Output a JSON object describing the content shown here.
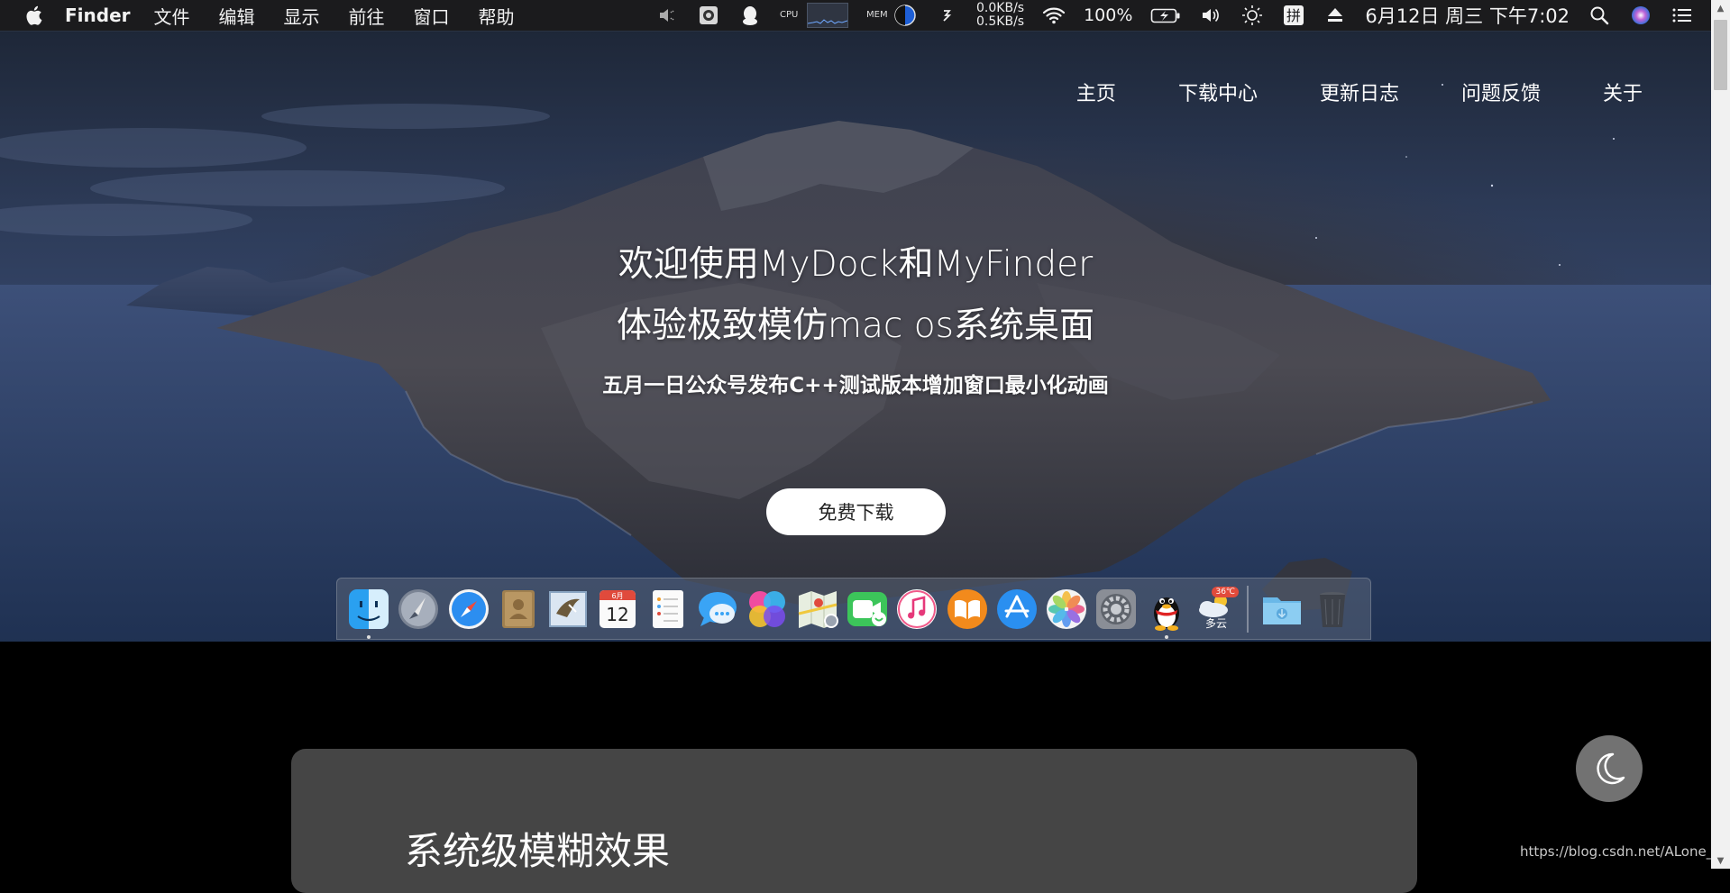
{
  "menubar": {
    "app_name": "Finder",
    "menus": [
      "文件",
      "编辑",
      "显示",
      "前往",
      "窗口",
      "帮助"
    ],
    "net_up": "0.0KB/s",
    "net_down": "0.5KB/s",
    "cpu_label": "CPU",
    "mem_label": "MEM",
    "battery": "100%",
    "clock": "6月12日 周三 下午7:02",
    "icons": [
      "apple-logo",
      "speaker-mute-icon",
      "screenshot-icon",
      "qq-icon",
      "cpu-graph",
      "memory-pie",
      "refresh-icon",
      "wifi-icon",
      "battery-charging-icon",
      "volume-icon",
      "brightness-icon",
      "pinyin-input-icon",
      "eject-icon",
      "spotlight-search-icon",
      "siri-icon",
      "notification-center-icon"
    ]
  },
  "hero": {
    "nav": [
      "主页",
      "下载中心",
      "更新日志",
      "问题反馈",
      "关于"
    ],
    "headline_1": "欢迎使用MyDock和MyFinder",
    "headline_2": "体验极致模仿mac os系统桌面",
    "subline": "五月一日公众号发布C++测试版本增加窗口最小化动画",
    "download_button": "免费下载"
  },
  "dock": {
    "apps": [
      "finder",
      "launchpad",
      "safari",
      "contacts",
      "mail",
      "calendar",
      "reminders",
      "messages",
      "game-center",
      "maps",
      "facetime",
      "itunes",
      "ibooks",
      "app-store",
      "photos",
      "system-preferences",
      "qq",
      "weather"
    ],
    "calendar_month": "6月",
    "calendar_day": "12",
    "weather_temp": "36℃",
    "weather_text": "多云",
    "running": [
      "finder",
      "qq"
    ],
    "trailing": [
      "downloads-folder",
      "trash"
    ]
  },
  "section": {
    "card_title": "系统级模糊效果"
  },
  "watermark": "https://blog.csdn.net/ALone_cat",
  "colors": {
    "menubar_bg": "#1b1b1d",
    "page_bg": "#000000",
    "card_bg": "#454545",
    "toggle_bg": "#727272"
  }
}
